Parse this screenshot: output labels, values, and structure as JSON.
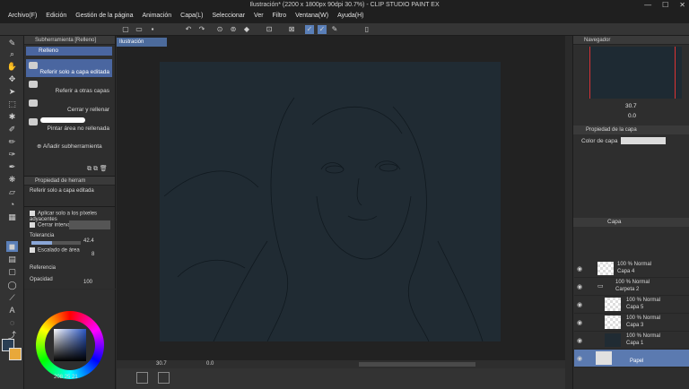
{
  "window": {
    "title": "Ilustración* (2200 x 1800px 90dpi 30.7%) - CLIP STUDIO PAINT EX",
    "controls": [
      "minimize-icon",
      "maximize-icon",
      "close-icon"
    ]
  },
  "menu": {
    "items": [
      "Archivo(F)",
      "Edición",
      "Gestión de la página",
      "Animación",
      "Capa(L)",
      "Seleccionar",
      "Ver",
      "Filtro",
      "Ventana(W)",
      "Ayuda(H)"
    ]
  },
  "subtool": {
    "header": "Subherramienta [Relleno]",
    "tab": "Relleno",
    "items": [
      {
        "label": "Referir solo a capa editada",
        "selected": true
      },
      {
        "label": "Referir a otras capas",
        "selected": false
      },
      {
        "label": "Cerrar y rellenar",
        "selected": false
      },
      {
        "label": "Pintar área no rellenada",
        "selected": false
      }
    ],
    "add_label": "Añadir subherramienta"
  },
  "toolprop": {
    "header": "Propiedad de herram",
    "name": "Referir solo a capa editada",
    "apply_adjacent": "Aplicar solo a los píxeles adyacentes",
    "close_gap": "Cerrar intervalo",
    "tolerance_label": "Tolerancia",
    "tolerance_value": "42.4",
    "tolerance_fraction": 0.42,
    "area_scale_label": "Escalado de área",
    "area_scale_value": "8",
    "reference_label": "Referencia",
    "opacity_label": "Opacidad",
    "opacity_value": "100"
  },
  "color": {
    "values": [
      "208",
      "25",
      "21"
    ],
    "main_color": "#2a3f55",
    "sub_color": "#e8a83a",
    "wheel_base": "#2a56c4"
  },
  "document": {
    "tab": "Ilustración",
    "background": "#202b33"
  },
  "status": {
    "zoom": "30.7",
    "rotation": "0.0"
  },
  "navigator": {
    "header": "Navegador",
    "zoom": "30.7",
    "rotation": "0.0"
  },
  "layerprop": {
    "header": "Propiedad de la capa",
    "color_label": "Color de capa"
  },
  "layers": {
    "header": "Capa",
    "items": [
      {
        "blend": "100 % Normal",
        "name": "Capa 4",
        "visible": true,
        "indent": false,
        "folder": false,
        "selected": false
      },
      {
        "blend": "100 % Normal",
        "name": "Carpeta 2",
        "visible": true,
        "indent": false,
        "folder": true,
        "selected": false
      },
      {
        "blend": "100 % Normal",
        "name": "Capa 5",
        "visible": true,
        "indent": true,
        "folder": false,
        "selected": false
      },
      {
        "blend": "100 % Normal",
        "name": "Capa 3",
        "visible": true,
        "indent": true,
        "folder": false,
        "selected": false
      },
      {
        "blend": "100 % Normal",
        "name": "Capa 1",
        "visible": true,
        "indent": true,
        "folder": false,
        "selected": false
      },
      {
        "blend": "",
        "name": "Papel",
        "visible": true,
        "indent": false,
        "folder": false,
        "selected": true
      }
    ]
  }
}
